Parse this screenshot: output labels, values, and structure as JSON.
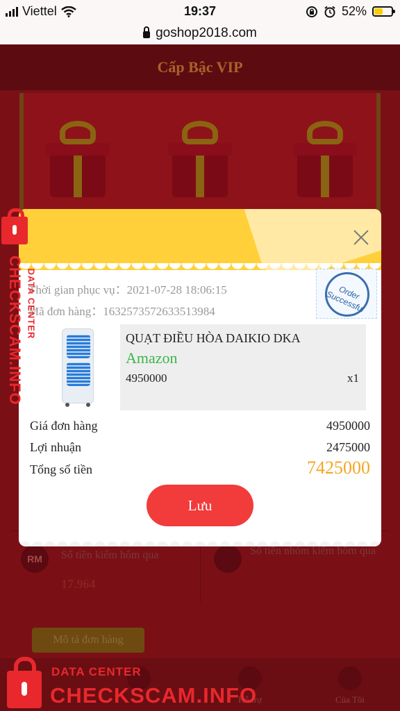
{
  "status_bar": {
    "carrier": "Viettel",
    "time": "19:37",
    "battery": "52%",
    "battery_level": 0.52,
    "icons": [
      "signal-bars-icon",
      "wifi-icon",
      "rotation-lock-icon",
      "alarm-icon",
      "battery-icon"
    ]
  },
  "browser": {
    "url": "goshop2018.com"
  },
  "background_page": {
    "title": "Cấp Bậc VIP",
    "stat_left_label": "Số tiền kiếm hôm qua",
    "stat_left_value": "17.964",
    "stat_left_icon_text": "RM",
    "stat_right_label": "Số tiền nhóm kiếm hôm qua",
    "order_tab": "Mô tả đơn hàng",
    "bottom_tabs": [
      "Hỗ trợ",
      "Của Tôi"
    ]
  },
  "modal": {
    "service_time_label": "Thời gian phục vụ：",
    "service_time": "2021-07-28 18:06:15",
    "order_id_label": "Mã đơn hàng：",
    "order_id": "1632573572633513984",
    "stamp_text": "Order Successful",
    "product": {
      "name": "QUẠT ĐIỀU HÒA DAIKIO DKA",
      "brand": "Amazon",
      "price": "4950000",
      "quantity": "x1"
    },
    "summary": {
      "order_price_label": "Giá đơn hàng",
      "order_price": "4950000",
      "profit_label": "Lợi nhuận",
      "profit": "2475000",
      "total_label": "Tổng số tiền",
      "total": "7425000"
    },
    "save_button": "Lưu"
  },
  "watermark": {
    "small": "DATA CENTER",
    "big": "CHECKSCAM.INFO"
  },
  "colors": {
    "modal_header": "#ffd03a",
    "brand_green": "#3cb44a",
    "total_orange": "#f5a623",
    "button_red": "#f23b3b",
    "watermark_red": "#e8282d"
  }
}
